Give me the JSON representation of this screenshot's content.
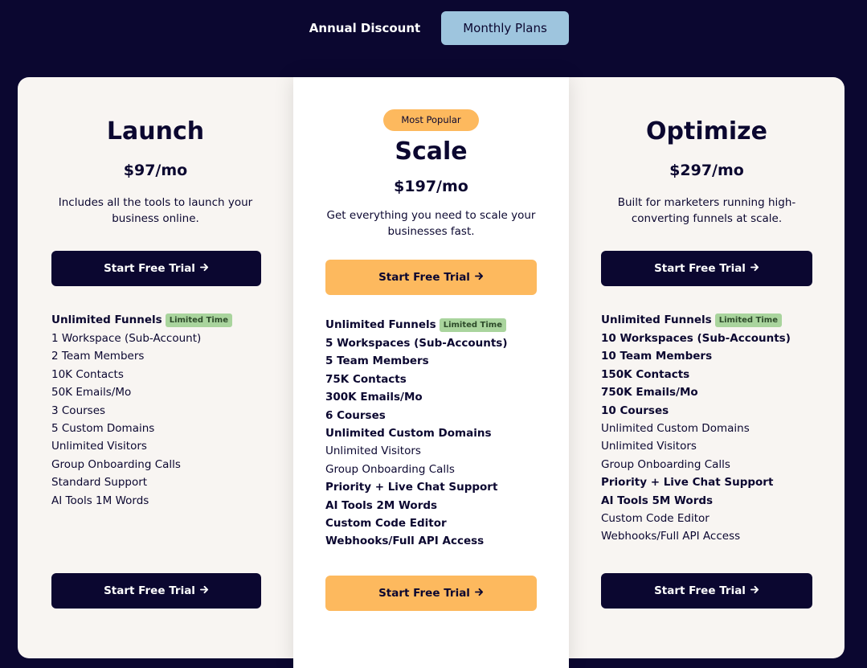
{
  "toggle": {
    "annual_label": "Annual Discount",
    "monthly_label": "Monthly Plans",
    "selected": "Monthly Plans"
  },
  "colors": {
    "background": "#0b0730",
    "accent_orange": "#fdb95e",
    "toggle_active": "#9ec5de",
    "limited_tag": "#a9d49d"
  },
  "plans": [
    {
      "title": "Launch",
      "price": "$97/mo",
      "description_line1": "Includes all the tools to launch your",
      "description_line2": "business online.",
      "cta_top": "Start Free Trial",
      "cta_bottom": "Start Free Trial",
      "features": [
        {
          "text": "Unlimited Funnels",
          "tag": "Limited Time",
          "bold": true
        },
        {
          "text": "1 Workspace (Sub-Account)",
          "bold": false
        },
        {
          "text": "2 Team Members",
          "bold": false
        },
        {
          "text": "10K Contacts",
          "bold": false
        },
        {
          "text": "50K Emails/Mo",
          "bold": false
        },
        {
          "text": "3 Courses",
          "bold": false
        },
        {
          "text": "5 Custom Domains",
          "bold": false
        },
        {
          "text": "Unlimited Visitors",
          "bold": false
        },
        {
          "text": "Group Onboarding Calls",
          "bold": false
        },
        {
          "text": "Standard Support",
          "bold": false
        },
        {
          "text": "AI Tools 1M Words",
          "bold": false
        }
      ]
    },
    {
      "badge": "Most Popular",
      "title": "Scale",
      "price": "$197/mo",
      "description_line1": "Get everything you need to scale your",
      "description_line2": "businesses fast.",
      "cta_top": "Start Free Trial",
      "cta_bottom": "Start Free Trial",
      "features": [
        {
          "text": "Unlimited Funnels",
          "tag": "Limited Time",
          "bold": true
        },
        {
          "text": "5 Workspaces (Sub-Accounts)",
          "bold": true
        },
        {
          "text": "5 Team Members",
          "bold": true
        },
        {
          "text": "75K Contacts",
          "bold": true
        },
        {
          "text": "300K Emails/Mo",
          "bold": true
        },
        {
          "text": "6 Courses",
          "bold": true
        },
        {
          "text": "Unlimited Custom Domains",
          "bold": true
        },
        {
          "text": "Unlimited Visitors",
          "bold": false
        },
        {
          "text": "Group Onboarding Calls",
          "bold": false
        },
        {
          "text": "Priority + Live Chat Support",
          "bold": true
        },
        {
          "text": "AI Tools 2M Words",
          "bold": true
        },
        {
          "text": "Custom Code Editor",
          "bold": true
        },
        {
          "text": "Webhooks/Full API Access",
          "bold": true
        }
      ]
    },
    {
      "title": "Optimize",
      "price": "$297/mo",
      "description_line1": "Built for marketers running high-",
      "description_line2": "converting funnels at scale.",
      "cta_top": "Start Free Trial",
      "cta_bottom": "Start Free Trial",
      "features": [
        {
          "text": "Unlimited Funnels",
          "tag": "Limited Time",
          "bold": true
        },
        {
          "text": "10 Workspaces (Sub-Accounts)",
          "bold": true
        },
        {
          "text": "10 Team Members",
          "bold": true
        },
        {
          "text": "150K Contacts",
          "bold": true
        },
        {
          "text": "750K Emails/Mo",
          "bold": true
        },
        {
          "text": "10 Courses",
          "bold": true
        },
        {
          "text": "Unlimited Custom Domains",
          "bold": false
        },
        {
          "text": "Unlimited Visitors",
          "bold": false
        },
        {
          "text": "Group Onboarding Calls",
          "bold": false
        },
        {
          "text": "Priority + Live Chat Support",
          "bold": true
        },
        {
          "text": "AI Tools 5M Words",
          "bold": true
        },
        {
          "text": "Custom Code Editor",
          "bold": false
        },
        {
          "text": "Webhooks/Full API Access",
          "bold": false
        }
      ]
    }
  ],
  "icons": {
    "cta_arrow": "arrow-right-icon"
  }
}
